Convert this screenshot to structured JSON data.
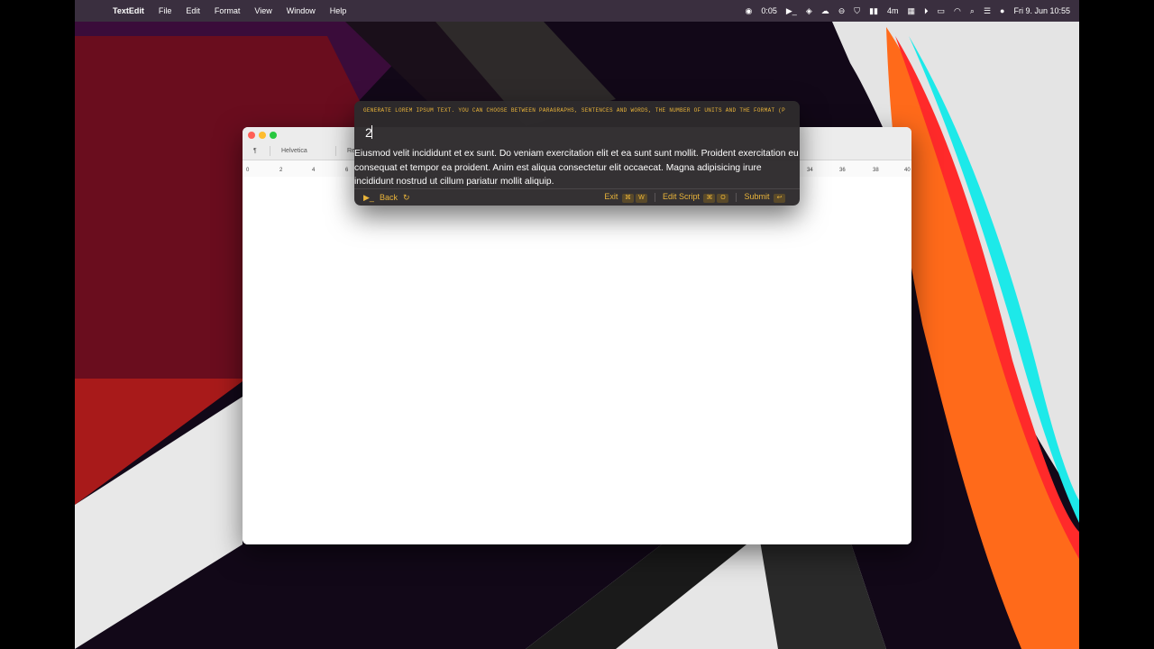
{
  "menubar": {
    "app_name": "TextEdit",
    "items": [
      "File",
      "Edit",
      "Format",
      "View",
      "Window",
      "Help"
    ],
    "timer": "0:05",
    "time_label": "4m",
    "date_time": "Fri 9. Jun  10:55"
  },
  "textedit": {
    "toolbar": {
      "paragraph_style": "¶",
      "font_family": "Helvetica",
      "font_style": "Regul"
    },
    "ruler_ticks": [
      "0",
      "2",
      "4",
      "6",
      "34",
      "36",
      "38",
      "40"
    ]
  },
  "panel": {
    "hint": "GENERATE LOREM IPSUM TEXT. YOU CAN CHOOSE BETWEEN PARAGRAPHS, SENTENCES AND WORDS, THE NUMBER OF UNITS AND THE FORMAT (P",
    "input_value": "2",
    "result_text": "Eiusmod velit incididunt et ex sunt. Do veniam exercitation elit et ea sunt sunt mollit. Proident exercitation eu consequat et tempor ea proident. Anim est aliqua consectetur elit occaecat. Magna adipisicing irure incididunt nostrud ut cillum pariatur mollit aliquip.",
    "footer": {
      "back_label": "Back",
      "exit_label": "Exit",
      "exit_keys": [
        "⌘",
        "W"
      ],
      "edit_label": "Edit Script",
      "edit_keys": [
        "⌘",
        "O"
      ],
      "submit_label": "Submit",
      "submit_key": "↩"
    }
  },
  "colors": {
    "accent": "#e9b43a",
    "panel_bg": "#2d2a2c"
  }
}
